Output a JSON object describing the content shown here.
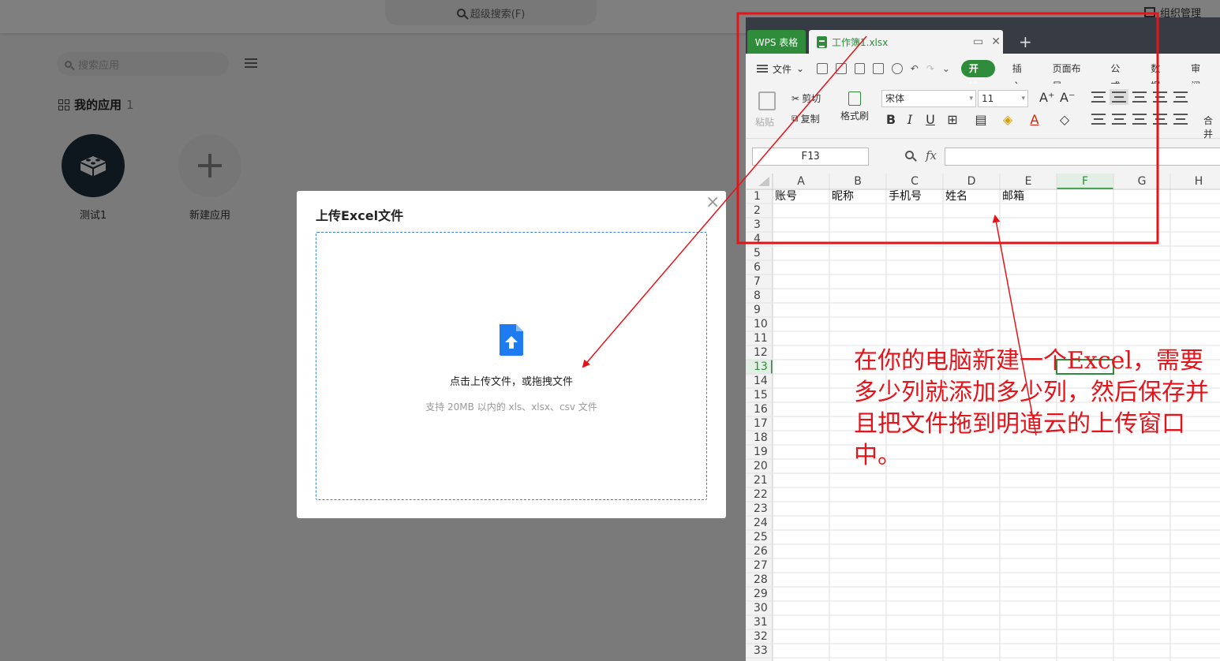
{
  "background_app": {
    "super_search": "超级搜索(F)",
    "org_manage": "组织管理",
    "search_placeholder": "搜索应用",
    "section_title": "我的应用",
    "section_count": "1",
    "apps": [
      {
        "name": "测试1"
      },
      {
        "name": "新建应用"
      }
    ]
  },
  "modal": {
    "title": "上传Excel文件",
    "close": "×",
    "drop_text": "点击上传文件，或拖拽文件",
    "drop_hint": "支持 20MB 以内的 xls、xlsx、csv 文件"
  },
  "wps": {
    "app_tab": "WPS 表格",
    "doc_tab": "工作簿1.xlsx",
    "new_tab": "+",
    "file_menu": "文件",
    "ribbon_tabs": [
      "开始",
      "插入",
      "页面布局",
      "公式",
      "数据",
      "审阅"
    ],
    "active_ribbon_tab": 0,
    "toolbar": {
      "paste": "粘贴",
      "cut": "剪切",
      "copy": "复制",
      "format_painter": "格式刷",
      "font_name": "宋体",
      "font_size": "11",
      "merge": "合并"
    },
    "name_box": "F13",
    "fx": "fx",
    "columns": [
      "A",
      "B",
      "C",
      "D",
      "E",
      "F",
      "G",
      "H"
    ],
    "selected_column": "F",
    "selected_row": 13,
    "row_count": 33,
    "header_row": [
      "账号",
      "昵称",
      "手机号",
      "姓名",
      "邮箱"
    ]
  },
  "annotation": {
    "text": "在你的电脑新建一个Excel，需要多少列就添加多少列，然后保存并且把文件拖到明道云的上传窗口中。",
    "color": "#e5141a"
  },
  "colors": {
    "wps_green": "#2f8c3a",
    "upload_blue": "#1e7bf0",
    "app_icon_dark": "#1f2f3d"
  }
}
